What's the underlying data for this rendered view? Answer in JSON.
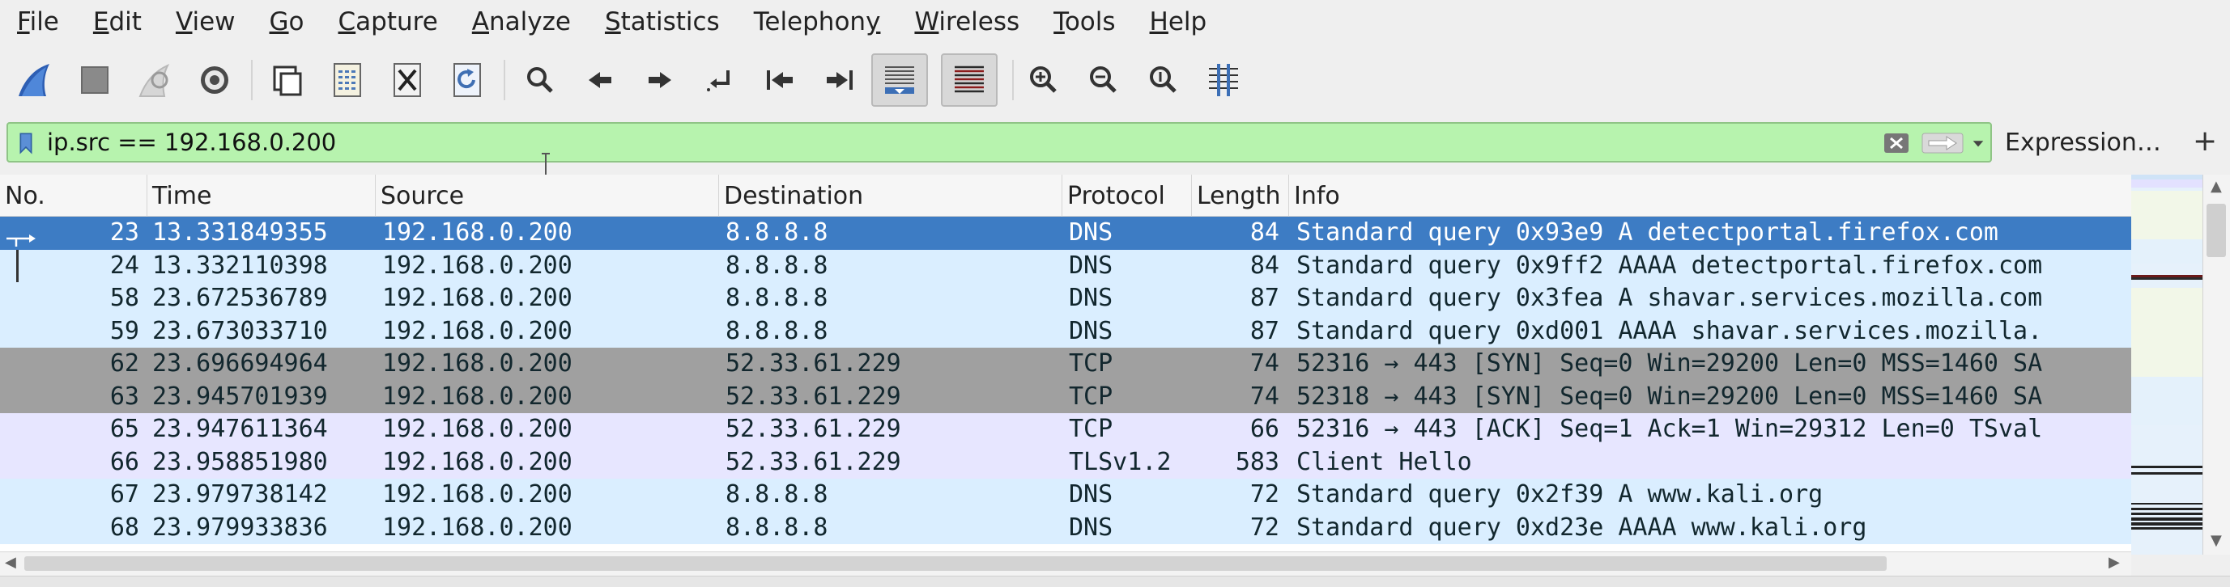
{
  "menu": [
    {
      "pre": "",
      "acc": "F",
      "post": "ile"
    },
    {
      "pre": "",
      "acc": "E",
      "post": "dit"
    },
    {
      "pre": "",
      "acc": "V",
      "post": "iew"
    },
    {
      "pre": "",
      "acc": "G",
      "post": "o"
    },
    {
      "pre": "",
      "acc": "C",
      "post": "apture"
    },
    {
      "pre": "",
      "acc": "A",
      "post": "nalyze"
    },
    {
      "pre": "",
      "acc": "S",
      "post": "tatistics"
    },
    {
      "pre": "Telephon",
      "acc": "y",
      "post": ""
    },
    {
      "pre": "",
      "acc": "W",
      "post": "ireless"
    },
    {
      "pre": "",
      "acc": "T",
      "post": "ools"
    },
    {
      "pre": "",
      "acc": "H",
      "post": "elp"
    }
  ],
  "toolbar_icons": [
    "shark-fin-start-capture-icon",
    "stop-capture-icon",
    "restart-capture-icon",
    "capture-options-icon",
    "open-file-icon",
    "save-file-icon",
    "close-file-icon",
    "reload-file-icon",
    "find-packet-icon",
    "go-back-icon",
    "go-forward-icon",
    "go-to-packet-icon",
    "go-first-packet-icon",
    "go-last-packet-icon",
    "autoscroll-icon",
    "colorize-icon",
    "zoom-in-icon",
    "zoom-out-icon",
    "normal-size-icon",
    "resize-columns-icon"
  ],
  "filter": {
    "value": "ip.src == 192.168.0.200",
    "expression_label": "Expression…",
    "plus_label": "+",
    "bg_color": "#b7f3ae"
  },
  "columns": [
    "No.",
    "Time",
    "Source",
    "Destination",
    "Protocol",
    "Length",
    "Info"
  ],
  "packets": [
    {
      "no": "23",
      "time": "13.331849355",
      "src": "192.168.0.200",
      "dst": "8.8.8.8",
      "proto": "DNS",
      "len": "84",
      "info": "Standard query 0x93e9 A detectportal.firefox.com",
      "style": "selected"
    },
    {
      "no": "24",
      "time": "13.332110398",
      "src": "192.168.0.200",
      "dst": "8.8.8.8",
      "proto": "DNS",
      "len": "84",
      "info": "Standard query 0x9ff2 AAAA detectportal.firefox.com",
      "style": "udp"
    },
    {
      "no": "58",
      "time": "23.672536789",
      "src": "192.168.0.200",
      "dst": "8.8.8.8",
      "proto": "DNS",
      "len": "87",
      "info": "Standard query 0x3fea A shavar.services.mozilla.com",
      "style": "udp"
    },
    {
      "no": "59",
      "time": "23.673033710",
      "src": "192.168.0.200",
      "dst": "8.8.8.8",
      "proto": "DNS",
      "len": "87",
      "info": "Standard query 0xd001 AAAA shavar.services.mozilla.",
      "style": "udp"
    },
    {
      "no": "62",
      "time": "23.696694964",
      "src": "192.168.0.200",
      "dst": "52.33.61.229",
      "proto": "TCP",
      "len": "74",
      "info": "52316 → 443 [SYN] Seq=0 Win=29200 Len=0 MSS=1460 SA",
      "style": "syn"
    },
    {
      "no": "63",
      "time": "23.945701939",
      "src": "192.168.0.200",
      "dst": "52.33.61.229",
      "proto": "TCP",
      "len": "74",
      "info": "52318 → 443 [SYN] Seq=0 Win=29200 Len=0 MSS=1460 SA",
      "style": "syn"
    },
    {
      "no": "65",
      "time": "23.947611364",
      "src": "192.168.0.200",
      "dst": "52.33.61.229",
      "proto": "TCP",
      "len": "66",
      "info": "52316 → 443 [ACK] Seq=1 Ack=1 Win=29312 Len=0 TSval",
      "style": "tcp"
    },
    {
      "no": "66",
      "time": "23.958851980",
      "src": "192.168.0.200",
      "dst": "52.33.61.229",
      "proto": "TLSv1.2",
      "len": "583",
      "info": "Client Hello",
      "style": "tcp"
    },
    {
      "no": "67",
      "time": "23.979738142",
      "src": "192.168.0.200",
      "dst": "8.8.8.8",
      "proto": "DNS",
      "len": "72",
      "info": "Standard query 0x2f39 A www.kali.org",
      "style": "udp"
    },
    {
      "no": "68",
      "time": "23.979933836",
      "src": "192.168.0.200",
      "dst": "8.8.8.8",
      "proto": "DNS",
      "len": "72",
      "info": "Standard query 0xd23e AAAA www.kali.org",
      "style": "udp"
    }
  ],
  "row_colors": {
    "selected": {
      "bg": "#3d7cc4",
      "fg": "#ffffff"
    },
    "udp": {
      "bg": "#daeeff",
      "fg": "#12272e"
    },
    "syn": {
      "bg": "#a0a0a0",
      "fg": "#12272e"
    },
    "tcp": {
      "bg": "#e7e6ff",
      "fg": "#12272e"
    }
  }
}
